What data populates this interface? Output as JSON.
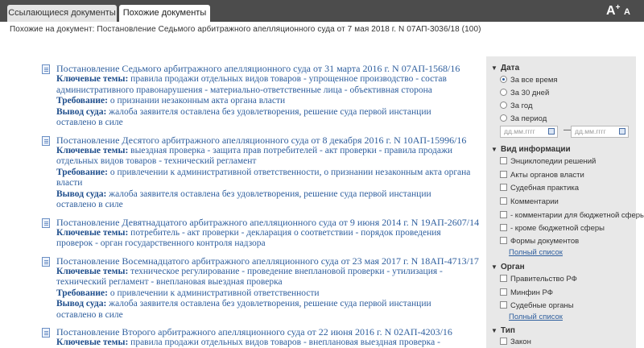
{
  "tabs": {
    "referring": "Ссылающиеся документы",
    "similar": "Похожие документы"
  },
  "font_controls": {
    "increase": "A",
    "increase_sup": "+",
    "decrease": "A"
  },
  "breadcrumb": "Похожие на документ: Постановление Седьмого арбитражного апелляционного суда от 7 мая 2018 г. N 07АП-3036/18 (100)",
  "results": [
    {
      "title": "Постановление Седьмого арбитражного апелляционного суда от 31 марта 2016 г. N 07АП-1568/16",
      "topics_label": "Ключевые темы:",
      "topics_l1": "правила продажи отдельных видов товаров - упрощенное производство - состав",
      "topics_l2": "административного правонарушения - материально-ответственные лица - объективная сторона",
      "demand_label": "Требование:",
      "demand_l1": "о признании незаконным акта органа власти",
      "demand_l2": "",
      "verdict_label": "Вывод суда:",
      "verdict_l1": "жалоба заявителя оставлена без удовлетворения, решение суда первой инстанции",
      "verdict_l2": "оставлено в силе"
    },
    {
      "title": "Постановление Десятого арбитражного апелляционного суда от 8 декабря 2016 г. N 10АП-15996/16",
      "topics_label": "Ключевые темы:",
      "topics_l1": "выездная проверка - защита прав потребителей - акт проверки - правила продажи",
      "topics_l2": "отдельных видов товаров - технический регламент",
      "demand_label": "Требование:",
      "demand_l1": "о привлечении к административной ответственности, о признании незаконным акта органа",
      "demand_l2": "власти",
      "verdict_label": "Вывод суда:",
      "verdict_l1": "жалоба заявителя оставлена без удовлетворения, решение суда первой инстанции",
      "verdict_l2": "оставлено в силе"
    },
    {
      "title": "Постановление Девятнадцатого арбитражного апелляционного суда от 9 июня 2014 г. N 19АП-2607/14",
      "topics_label": "Ключевые темы:",
      "topics_l1": "потребитель - акт проверки - декларация о соответствии - порядок проведения",
      "topics_l2": "проверок - орган государственного контроля надзора",
      "demand_label": "",
      "demand_l1": "",
      "demand_l2": "",
      "verdict_label": "",
      "verdict_l1": "",
      "verdict_l2": ""
    },
    {
      "title": "Постановление Восемнадцатого арбитражного апелляционного суда от 23 мая 2017 г. N 18АП-4713/17",
      "topics_label": "Ключевые темы:",
      "topics_l1": "техническое регулирование - проведение внеплановой проверки - утилизация -",
      "topics_l2": "технический регламент - внеплановая выездная проверка",
      "demand_label": "Требование:",
      "demand_l1": "о привлечении к административной ответственности",
      "demand_l2": "",
      "verdict_label": "Вывод суда:",
      "verdict_l1": "жалоба заявителя оставлена без удовлетворения, решение суда первой инстанции",
      "verdict_l2": "оставлено в силе"
    },
    {
      "title": "Постановление Второго арбитражного апелляционного суда от 22 июня 2016 г. N 02АП-4203/16",
      "topics_label": "Ключевые темы:",
      "topics_l1": "правила продажи отдельных видов товаров - внеплановая выездная проверка -",
      "topics_l2": "",
      "demand_label": "",
      "demand_l1": "",
      "demand_l2": "",
      "verdict_label": "",
      "verdict_l1": "",
      "verdict_l2": ""
    }
  ],
  "filters": {
    "date": {
      "title": "Дата",
      "options": [
        "За все время",
        "За 30 дней",
        "За год",
        "За период"
      ],
      "selected": "За все время",
      "from_placeholder": "дд.мм.гггг",
      "to_placeholder": "дд.мм.гггг",
      "dash": "—"
    },
    "info_type": {
      "title": "Вид информации",
      "options": [
        "Энциклопедии решений",
        "Акты органов власти",
        "Судебная практика",
        "Комментарии",
        "- комментарии для бюджетной сферы",
        "- кроме бюджетной сферы",
        "Формы документов"
      ],
      "full_list": "Полный список"
    },
    "organ": {
      "title": "Орган",
      "options": [
        "Правительство РФ",
        "Минфин РФ",
        "Судебные органы"
      ],
      "full_list": "Полный список"
    },
    "type": {
      "title": "Тип",
      "options": [
        "Закон"
      ]
    }
  }
}
